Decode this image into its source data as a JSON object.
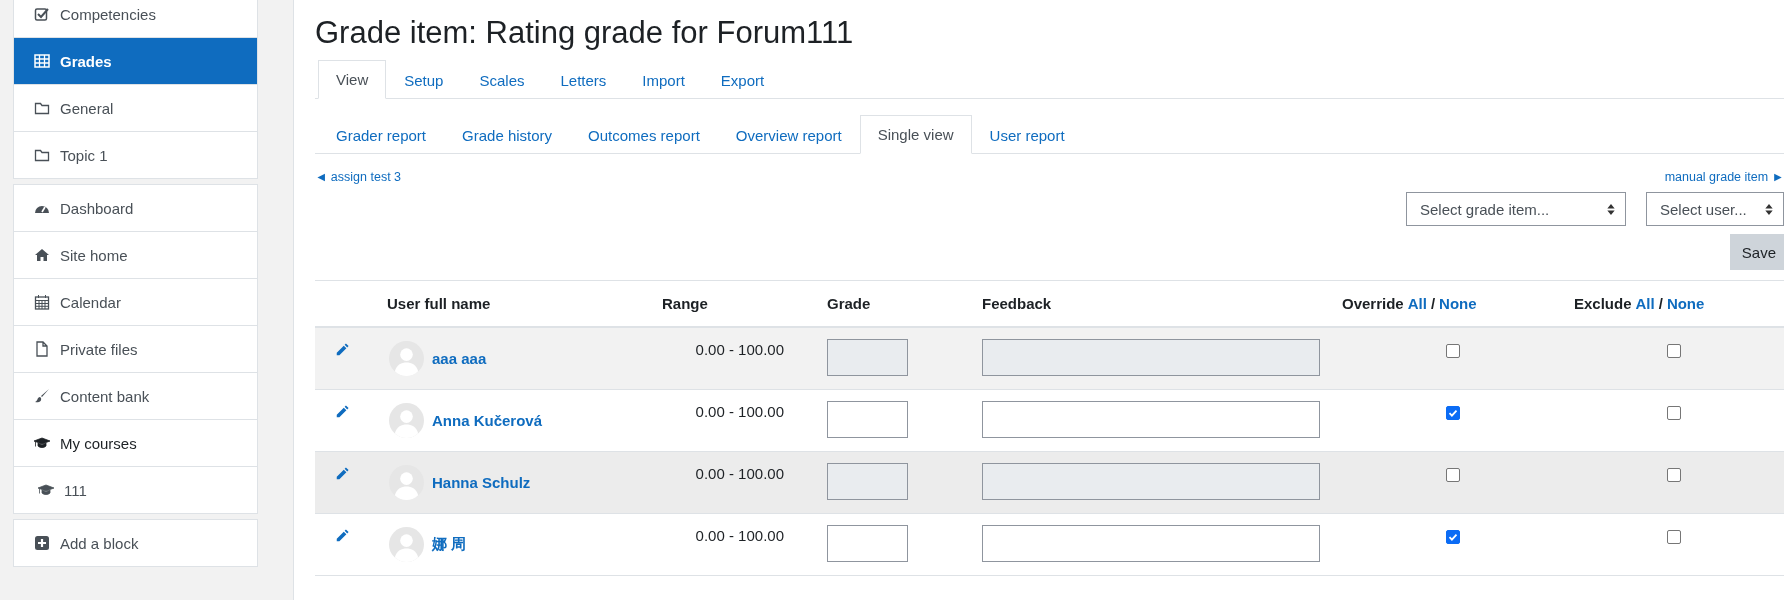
{
  "sidebar": {
    "groups": [
      {
        "items": [
          {
            "label": "Competencies",
            "selected": false
          },
          {
            "label": "Grades",
            "selected": true
          },
          {
            "label": "General",
            "selected": false
          },
          {
            "label": "Topic 1",
            "selected": false
          }
        ]
      },
      {
        "items": [
          {
            "label": "Dashboard",
            "selected": false
          },
          {
            "label": "Site home",
            "selected": false
          },
          {
            "label": "Calendar",
            "selected": false
          },
          {
            "label": "Private files",
            "selected": false
          },
          {
            "label": "Content bank",
            "selected": false
          },
          {
            "label": "My courses",
            "selected": false,
            "children": [
              {
                "label": "111",
                "selected": false
              }
            ]
          }
        ]
      },
      {
        "items": [
          {
            "label": "Add a block",
            "selected": false
          }
        ]
      }
    ]
  },
  "page_title": "Grade item: Rating grade for Forum111",
  "tabs": [
    {
      "label": "View",
      "selected": true
    },
    {
      "label": "Setup",
      "selected": false
    },
    {
      "label": "Scales",
      "selected": false
    },
    {
      "label": "Letters",
      "selected": false
    },
    {
      "label": "Import",
      "selected": false
    },
    {
      "label": "Export",
      "selected": false
    }
  ],
  "report_tabs": [
    {
      "label": "Grader report",
      "selected": false
    },
    {
      "label": "Grade history",
      "selected": false
    },
    {
      "label": "Outcomes report",
      "selected": false
    },
    {
      "label": "Overview report",
      "selected": false
    },
    {
      "label": "Single view",
      "selected": true
    },
    {
      "label": "User report",
      "selected": false
    }
  ],
  "prev_link": "◄ assign test 3",
  "next_link": "manual grade item ►",
  "selects": [
    "Select grade item...",
    "Select user..."
  ],
  "save_button": "Save",
  "table": {
    "columns": [
      "User full name",
      "Range",
      "Grade",
      "Feedback"
    ],
    "override": {
      "label": "Override",
      "all": "All",
      "separator": "/",
      "none": "None"
    },
    "exclude": {
      "label": "Exclude",
      "all": "All",
      "separator": "/",
      "none": "None"
    },
    "rows": [
      {
        "name": "aaa aaa",
        "range": "0.00 - 100.00",
        "override": false,
        "exclude": false
      },
      {
        "name": "Anna Kučerová",
        "range": "0.00 - 100.00",
        "override": true,
        "exclude": false
      },
      {
        "name": "Hanna Schulz",
        "range": "0.00 - 100.00",
        "override": false,
        "exclude": false
      },
      {
        "name": "娜 周",
        "range": "0.00 - 100.00",
        "override": true,
        "exclude": false
      }
    ]
  }
}
